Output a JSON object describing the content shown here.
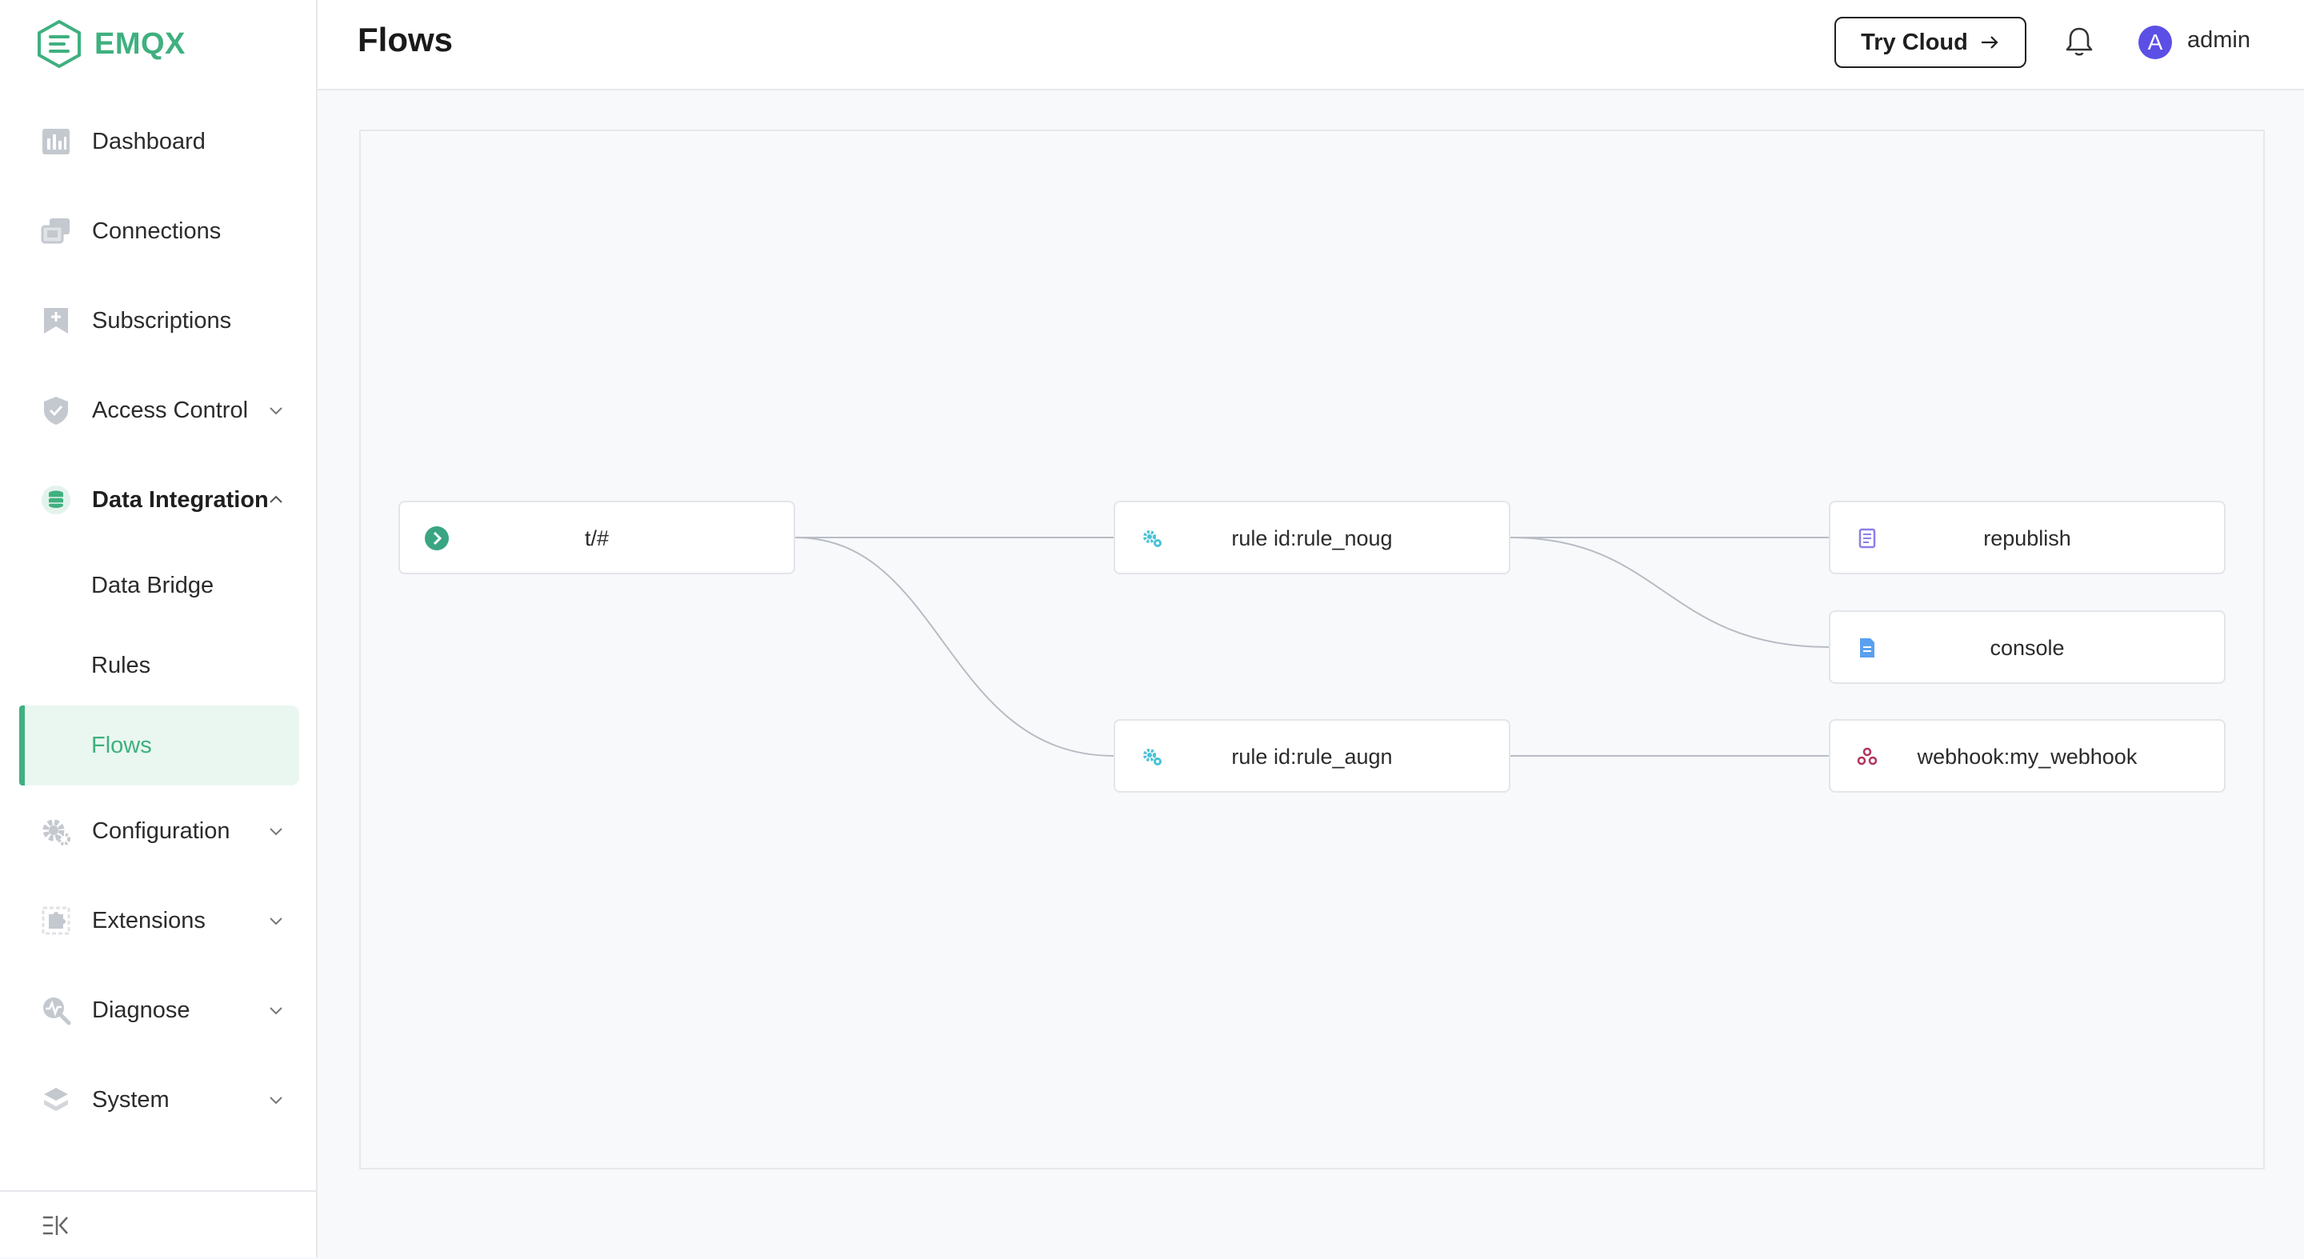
{
  "app": {
    "name": "EMQX",
    "brand_color": "#3fb07f"
  },
  "sidebar": {
    "items": [
      {
        "label": "Dashboard",
        "icon": "dashboard-icon"
      },
      {
        "label": "Connections",
        "icon": "connections-icon"
      },
      {
        "label": "Subscriptions",
        "icon": "subscriptions-icon"
      },
      {
        "label": "Access Control",
        "icon": "shield-icon",
        "expandable": true,
        "expanded": false
      },
      {
        "label": "Data Integration",
        "icon": "database-icon",
        "expandable": true,
        "expanded": true,
        "children": [
          {
            "label": "Data Bridge"
          },
          {
            "label": "Rules"
          },
          {
            "label": "Flows",
            "active": true
          }
        ]
      },
      {
        "label": "Configuration",
        "icon": "gear-icon",
        "expandable": true,
        "expanded": false
      },
      {
        "label": "Extensions",
        "icon": "puzzle-icon",
        "expandable": true,
        "expanded": false
      },
      {
        "label": "Diagnose",
        "icon": "diagnose-icon",
        "expandable": true,
        "expanded": false
      },
      {
        "label": "System",
        "icon": "layers-icon",
        "expandable": true,
        "expanded": false
      }
    ],
    "collapse_icon": "collapse-sidebar-icon"
  },
  "header": {
    "title": "Flows",
    "try_cloud_label": "Try Cloud",
    "avatar_initial": "A",
    "username": "admin"
  },
  "flow": {
    "nodes": [
      {
        "id": "source",
        "label": "t/#",
        "icon": "topic-icon"
      },
      {
        "id": "rule1",
        "label": "rule id:rule_noug",
        "icon": "rule-gears-icon"
      },
      {
        "id": "rule2",
        "label": "rule id:rule_augn",
        "icon": "rule-gears-icon"
      },
      {
        "id": "act1",
        "label": "republish",
        "icon": "republish-icon"
      },
      {
        "id": "act2",
        "label": "console",
        "icon": "console-icon"
      },
      {
        "id": "act3",
        "label": "webhook:my_webhook",
        "icon": "webhook-icon"
      }
    ],
    "edges": [
      [
        "source",
        "rule1"
      ],
      [
        "source",
        "rule2"
      ],
      [
        "rule1",
        "act1"
      ],
      [
        "rule1",
        "act2"
      ],
      [
        "rule2",
        "act3"
      ]
    ]
  }
}
